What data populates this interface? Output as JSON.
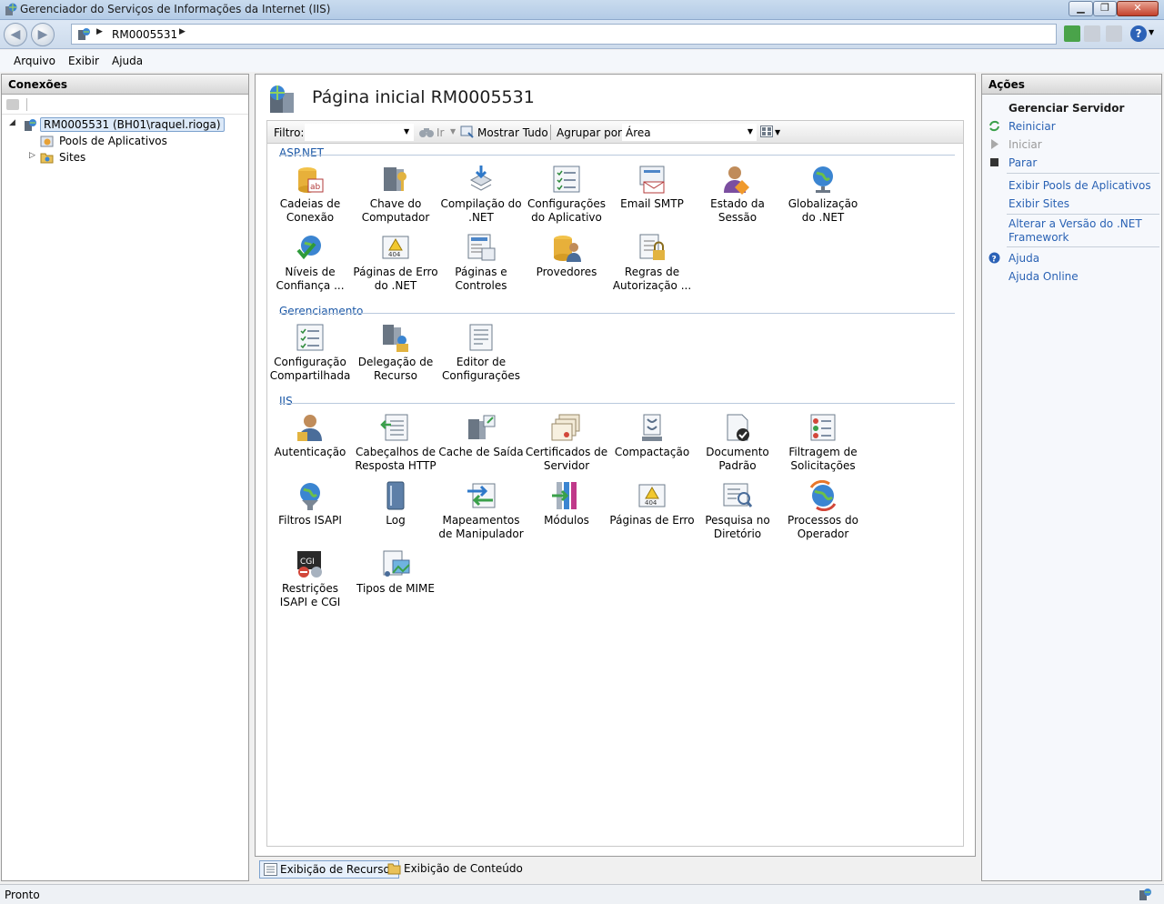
{
  "window": {
    "title": "Gerenciador do Serviços de Informações da Internet (IIS)",
    "icon": "iis-manager-icon"
  },
  "address": {
    "crumbs": [
      "RM0005531"
    ],
    "icon": "server-globe-icon"
  },
  "menu": {
    "items": [
      "Arquivo",
      "Exibir",
      "Ajuda"
    ]
  },
  "connections": {
    "title": "Conexões",
    "tree": {
      "server": "RM0005531 (BH01\\raquel.rioga)",
      "pools": "Pools de Aplicativos",
      "sites": "Sites"
    }
  },
  "main": {
    "title": "Página inicial RM0005531",
    "filter": {
      "label": "Filtro:",
      "value": "",
      "go_label": "Ir",
      "show_all": "Mostrar Tudo",
      "group_by_label": "Agrupar por:",
      "group_by_value": "Área"
    },
    "groups": [
      {
        "name": "ASP.NET",
        "features": [
          {
            "label": "Cadeias de Conexão",
            "icon": "connection-strings-icon"
          },
          {
            "label": "Chave do Computador",
            "icon": "machine-key-icon"
          },
          {
            "label": "Compilação do .NET",
            "icon": "net-compilation-icon"
          },
          {
            "label": "Configurações do Aplicativo",
            "icon": "app-settings-icon"
          },
          {
            "label": "Email SMTP",
            "icon": "smtp-email-icon"
          },
          {
            "label": "Estado da Sessão",
            "icon": "session-state-icon"
          },
          {
            "label": "Globalização do .NET",
            "icon": "net-globalization-icon"
          },
          {
            "label": "Níveis de Confiança ...",
            "icon": "trust-levels-icon"
          },
          {
            "label": "Páginas de Erro do .NET",
            "icon": "net-error-pages-icon"
          },
          {
            "label": "Páginas e Controles",
            "icon": "pages-controls-icon"
          },
          {
            "label": "Provedores",
            "icon": "providers-icon"
          },
          {
            "label": "Regras de Autorização ...",
            "icon": "authorization-rules-icon"
          }
        ]
      },
      {
        "name": "Gerenciamento",
        "features": [
          {
            "label": "Configuração Compartilhada",
            "icon": "shared-config-icon"
          },
          {
            "label": "Delegação de Recurso",
            "icon": "feature-delegation-icon"
          },
          {
            "label": "Editor de Configurações",
            "icon": "config-editor-icon"
          }
        ]
      },
      {
        "name": "IIS",
        "features": [
          {
            "label": "Autenticação",
            "icon": "authentication-icon"
          },
          {
            "label": "Cabeçalhos de Resposta HTTP",
            "icon": "http-response-headers-icon"
          },
          {
            "label": "Cache de Saída",
            "icon": "output-cache-icon"
          },
          {
            "label": "Certificados de Servidor",
            "icon": "server-certificates-icon"
          },
          {
            "label": "Compactação",
            "icon": "compression-icon"
          },
          {
            "label": "Documento Padrão",
            "icon": "default-document-icon"
          },
          {
            "label": "Filtragem de Solicitações",
            "icon": "request-filtering-icon"
          },
          {
            "label": "Filtros ISAPI",
            "icon": "isapi-filters-icon"
          },
          {
            "label": "Log",
            "icon": "logging-icon"
          },
          {
            "label": "Mapeamentos de Manipulador",
            "icon": "handler-mappings-icon"
          },
          {
            "label": "Módulos",
            "icon": "modules-icon"
          },
          {
            "label": "Páginas de Erro",
            "icon": "error-pages-icon"
          },
          {
            "label": "Pesquisa no Diretório",
            "icon": "directory-browsing-icon"
          },
          {
            "label": "Processos do Operador",
            "icon": "worker-processes-icon"
          },
          {
            "label": "Restrições ISAPI e CGI",
            "icon": "isapi-cgi-restrictions-icon"
          },
          {
            "label": "Tipos de MIME",
            "icon": "mime-types-icon"
          }
        ]
      }
    ]
  },
  "view_tabs": {
    "features": "Exibição de Recursos",
    "content": "Exibição de Conteúdo"
  },
  "actions": {
    "title": "Ações",
    "heading": "Gerenciar Servidor",
    "restart": "Reiniciar",
    "start": "Iniciar",
    "stop": "Parar",
    "view_pools": "Exibir Pools de Aplicativos",
    "view_sites": "Exibir Sites",
    "change_net": "Alterar a Versão do .NET Framework",
    "help": "Ajuda",
    "help_online": "Ajuda Online"
  },
  "status": {
    "text": "Pronto"
  },
  "colors": {
    "link": "#2a62b4",
    "group_header": "#1a57a6",
    "disabled": "#9a9a9a"
  }
}
